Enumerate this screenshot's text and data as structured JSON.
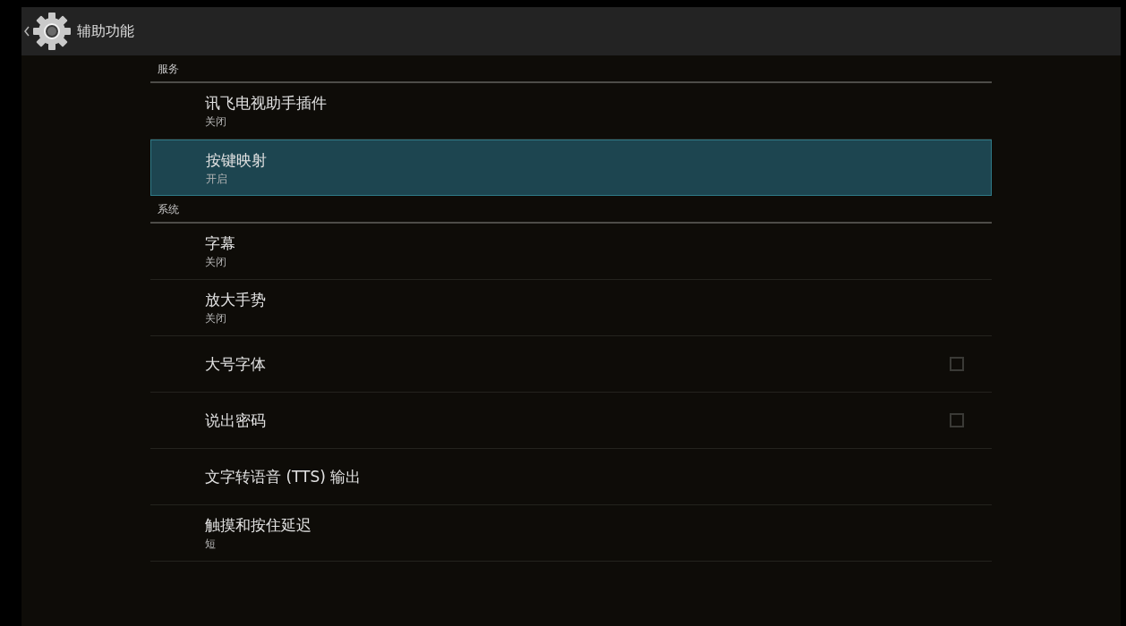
{
  "header": {
    "title": "辅助功能"
  },
  "sections": [
    {
      "title": "服务",
      "items": [
        {
          "kind": "text",
          "title": "讯飞电视助手插件",
          "summary": "关闭",
          "selected": false
        },
        {
          "kind": "text",
          "title": "按键映射",
          "summary": "开启",
          "selected": true
        }
      ]
    },
    {
      "title": "系统",
      "items": [
        {
          "kind": "text",
          "title": "字幕",
          "summary": "关闭",
          "selected": false
        },
        {
          "kind": "text",
          "title": "放大手势",
          "summary": "关闭",
          "selected": false
        },
        {
          "kind": "checkbox",
          "title": "大号字体",
          "checked": false,
          "selected": false
        },
        {
          "kind": "checkbox",
          "title": "说出密码",
          "checked": false,
          "selected": false
        },
        {
          "kind": "text",
          "title": "文字转语音 (TTS) 输出",
          "selected": false
        },
        {
          "kind": "text",
          "title": "触摸和按住延迟",
          "summary": "短",
          "selected": false
        }
      ]
    }
  ]
}
